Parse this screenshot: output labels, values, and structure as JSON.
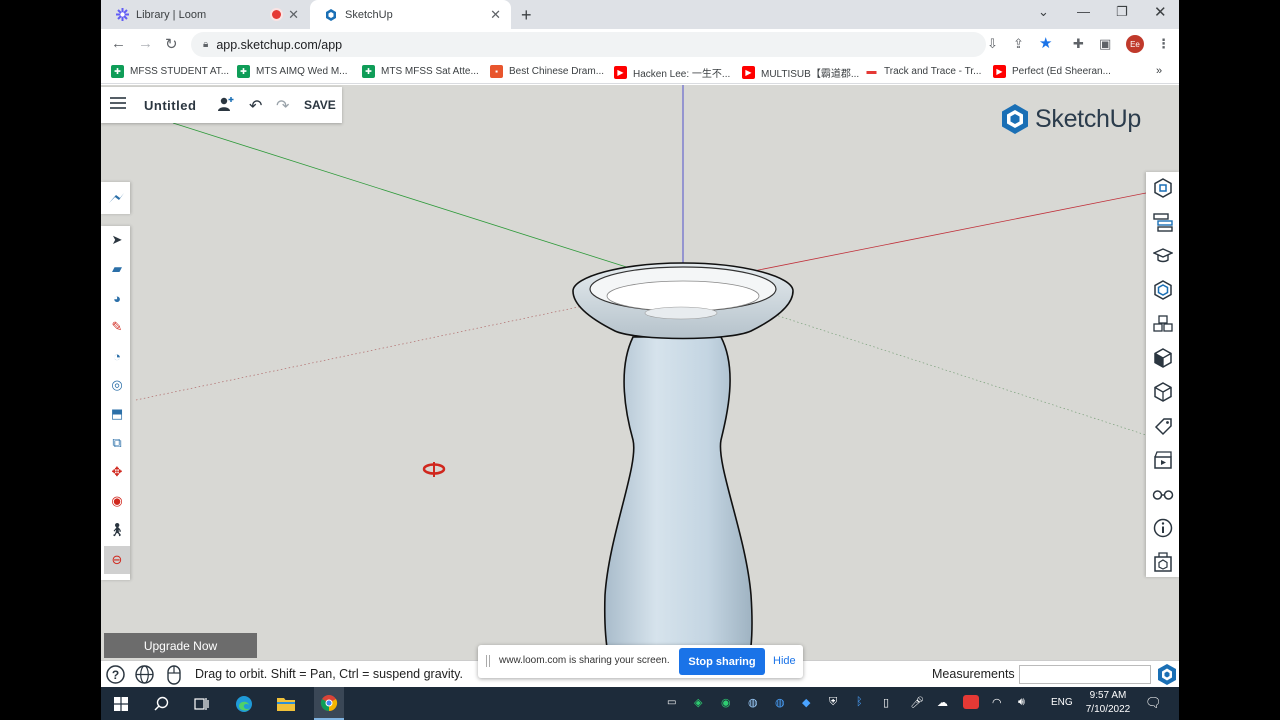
{
  "browser": {
    "tabs": [
      {
        "label": "Library | Loom",
        "active": false,
        "recording": true
      },
      {
        "label": "SketchUp",
        "active": true
      }
    ],
    "url": "app.sketchup.com/app",
    "profile_initials": "Ee"
  },
  "bookmarks": [
    {
      "label": "MFSS STUDENT AT...",
      "icon": "sheets-icon",
      "color": "#0f9d58"
    },
    {
      "label": "MTS AIMQ Wed M...",
      "icon": "sheets-icon",
      "color": "#0f9d58"
    },
    {
      "label": "MTS MFSS Sat Atte...",
      "icon": "sheets-icon",
      "color": "#0f9d58"
    },
    {
      "label": "Best Chinese Dram...",
      "icon": "gift-icon",
      "color": "#e8552d"
    },
    {
      "label": "Hacken Lee: 一生不...",
      "icon": "youtube-icon",
      "color": "#ff0000"
    },
    {
      "label": "MULTISUB【霸道郡...",
      "icon": "youtube-icon",
      "color": "#ff0000"
    },
    {
      "label": "Track and Trace - Tr...",
      "icon": "royal-mail-icon",
      "color": "#e53935"
    },
    {
      "label": "Perfect (Ed Sheeran...",
      "icon": "youtube-icon",
      "color": "#ff0000"
    }
  ],
  "app": {
    "title": "Untitled",
    "save_label": "SAVE",
    "brand": "SketchUp",
    "upgrade_label": "Upgrade Now",
    "status_hint": "Drag to orbit. Shift = Pan, Ctrl = suspend gravity.",
    "measurements_label": "Measurements",
    "measurements_value": ""
  },
  "loom": {
    "message": "www.loom.com is sharing your screen.",
    "stop_label": "Stop sharing",
    "hide_label": "Hide"
  },
  "taskbar": {
    "language": "ENG",
    "time": "9:57 AM",
    "date": "7/10/2022"
  },
  "colors": {
    "axis_red": "#c0303a",
    "axis_green": "#2e9a3a",
    "axis_blue": "#3030c8",
    "sketchup_blue": "#1a6fb5",
    "loom_blue": "#1a73e8"
  }
}
